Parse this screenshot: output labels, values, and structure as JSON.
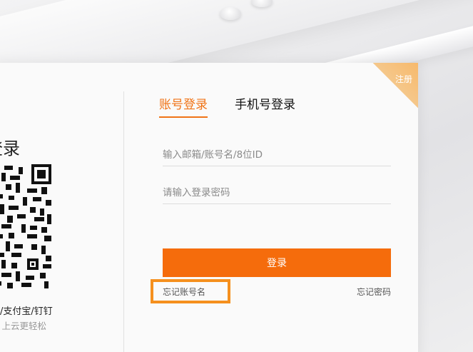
{
  "register": {
    "label": "注册"
  },
  "qr_panel": {
    "title": "登录",
    "apps_text": "/支付宝/钉钉",
    "hint_text": "，上云更轻松"
  },
  "tabs": [
    {
      "label": "账号登录",
      "active": true
    },
    {
      "label": "手机号登录",
      "active": false
    }
  ],
  "form": {
    "username_placeholder": "输入邮箱/账号名/8位ID",
    "password_placeholder": "请输入登录密码",
    "login_label": "登录",
    "forgot_account_label": "忘记账号名",
    "forgot_password_label": "忘记密码"
  },
  "colors": {
    "accent": "#f56c0c",
    "tab_active": "#f07316",
    "register_corner": "#f5c78a",
    "highlight": "#f5901e"
  }
}
